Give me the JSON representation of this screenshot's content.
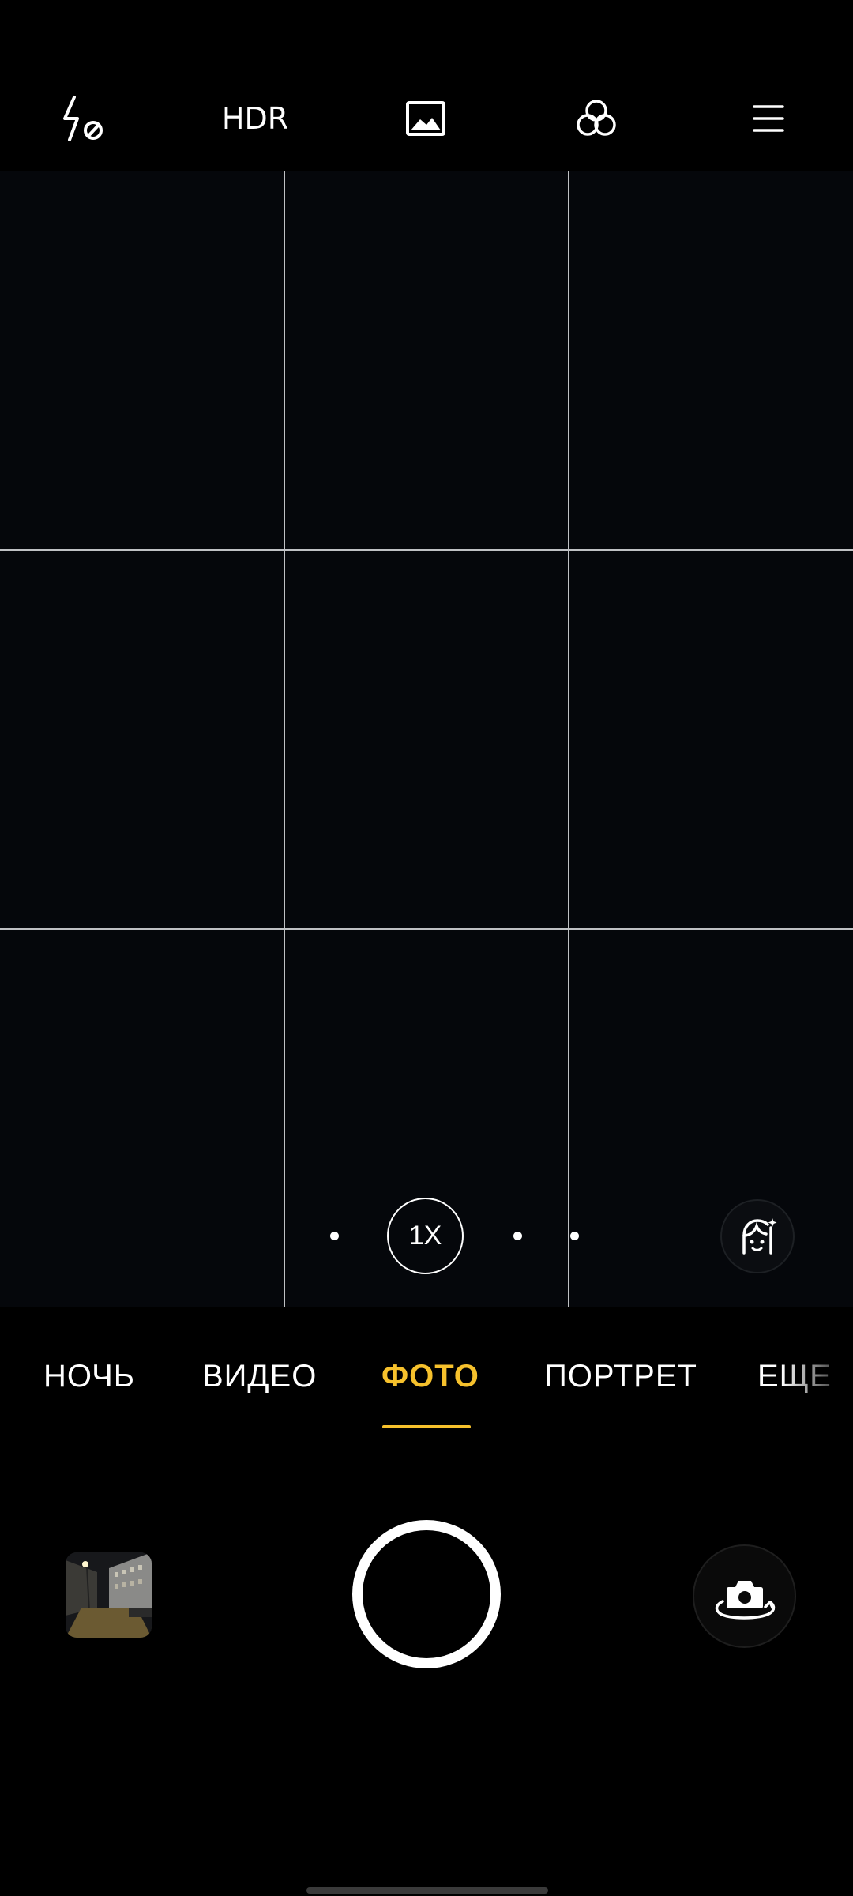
{
  "top_bar": {
    "flash_icon": "flash-off-icon",
    "hdr_label": "HDR",
    "photo_ratio_icon": "image-icon",
    "filters_icon": "filters-icon",
    "menu_icon": "menu-icon"
  },
  "viewfinder": {
    "zoom_label": "1X",
    "beauty_icon": "face-beauty-icon"
  },
  "modes": [
    {
      "label": "НОЧЬ"
    },
    {
      "label": "ВИДЕО"
    },
    {
      "label": "ФОТО"
    },
    {
      "label": "ПОРТРЕТ"
    },
    {
      "label": "ЕЩЕ"
    }
  ],
  "active_mode": "ФОТО",
  "bottom": {
    "gallery_icon": "gallery-thumbnail",
    "shutter_icon": "shutter-button",
    "flip_icon": "switch-camera-icon"
  },
  "colors": {
    "accent": "#f6c12c",
    "background": "#000000",
    "viewfinder": "#05070b"
  }
}
